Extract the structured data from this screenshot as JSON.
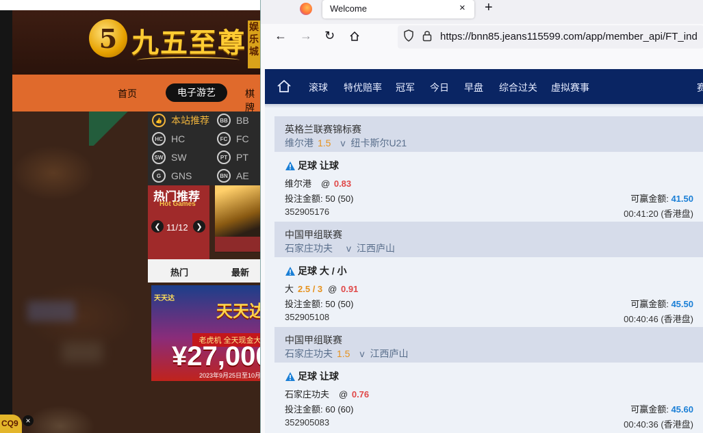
{
  "left": {
    "logo_text": "九五至尊",
    "logo_digit": "5",
    "side_tag": "娱乐城",
    "nav": [
      "首页",
      "电子游艺",
      "棋牌"
    ],
    "categories": [
      {
        "code": "👍",
        "label": "本站推荐"
      },
      {
        "code": "BB",
        "label": "BB"
      },
      {
        "code": "HC",
        "label": "HC"
      },
      {
        "code": "FC",
        "label": "FC"
      },
      {
        "code": "SW",
        "label": "SW"
      },
      {
        "code": "PT",
        "label": "PT"
      },
      {
        "code": "G",
        "label": "GNS"
      },
      {
        "code": "BN",
        "label": "AE"
      }
    ],
    "hot_title": "热门推荐",
    "hot_subtitle": "Hot Games",
    "hot_page": "11/12",
    "tabs": [
      "热门",
      "最新"
    ],
    "promo": {
      "brand": "天天达",
      "title": "天天达",
      "subtitle": "老虎机 全天现金大",
      "amount": "¥27,000",
      "date": "2023年9月25日至10月"
    },
    "badge": "CQ9",
    "close": "×"
  },
  "browser": {
    "tab_title": "Welcome",
    "tab_close": "×",
    "new_tab": "+",
    "url": "https://bnn85.jeans115599.com/app/member_api/FT_ind"
  },
  "site": {
    "nav": [
      "滚球",
      "特优赔率",
      "冠军",
      "今日",
      "早盘",
      "综合过关",
      "虚拟赛事",
      "赛"
    ],
    "bets": [
      {
        "league": "英格兰联赛锦标赛",
        "home": "维尔港",
        "handicap": "1.5",
        "vs": "v",
        "away": "纽卡斯尔U21",
        "type": "足球 让球",
        "pick_team": "维尔港",
        "pick_line": "",
        "odds": "0.83",
        "stake_label": "投注金额:",
        "stake": "50 (50)",
        "win_label": "可赢金额:",
        "win": "41.50",
        "ticket": "352905176",
        "time": "00:41:20 (香港盘)"
      },
      {
        "league": "中国甲组联赛",
        "home": "石家庄功夫",
        "handicap": "",
        "vs": "v",
        "away": "江西庐山",
        "type": "足球 大 / 小",
        "pick_team": "大",
        "pick_line": "2.5 / 3",
        "odds": "0.91",
        "stake_label": "投注金额:",
        "stake": "50 (50)",
        "win_label": "可赢金额:",
        "win": "45.50",
        "ticket": "352905108",
        "time": "00:40:46 (香港盘)"
      },
      {
        "league": "中国甲组联赛",
        "home": "石家庄功夫",
        "handicap": "1.5",
        "vs": "v",
        "away": "江西庐山",
        "type": "足球 让球",
        "pick_team": "石家庄功夫",
        "pick_line": "",
        "odds": "0.76",
        "stake_label": "投注金额:",
        "stake": "60 (60)",
        "win_label": "可赢金额:",
        "win": "45.60",
        "ticket": "352905083",
        "time": "00:40:36 (香港盘)"
      }
    ]
  },
  "colors": {
    "site_nav": "#0a2563",
    "handicap": "#e6921e",
    "odds": "#e04848",
    "win": "#1a7fd6"
  }
}
